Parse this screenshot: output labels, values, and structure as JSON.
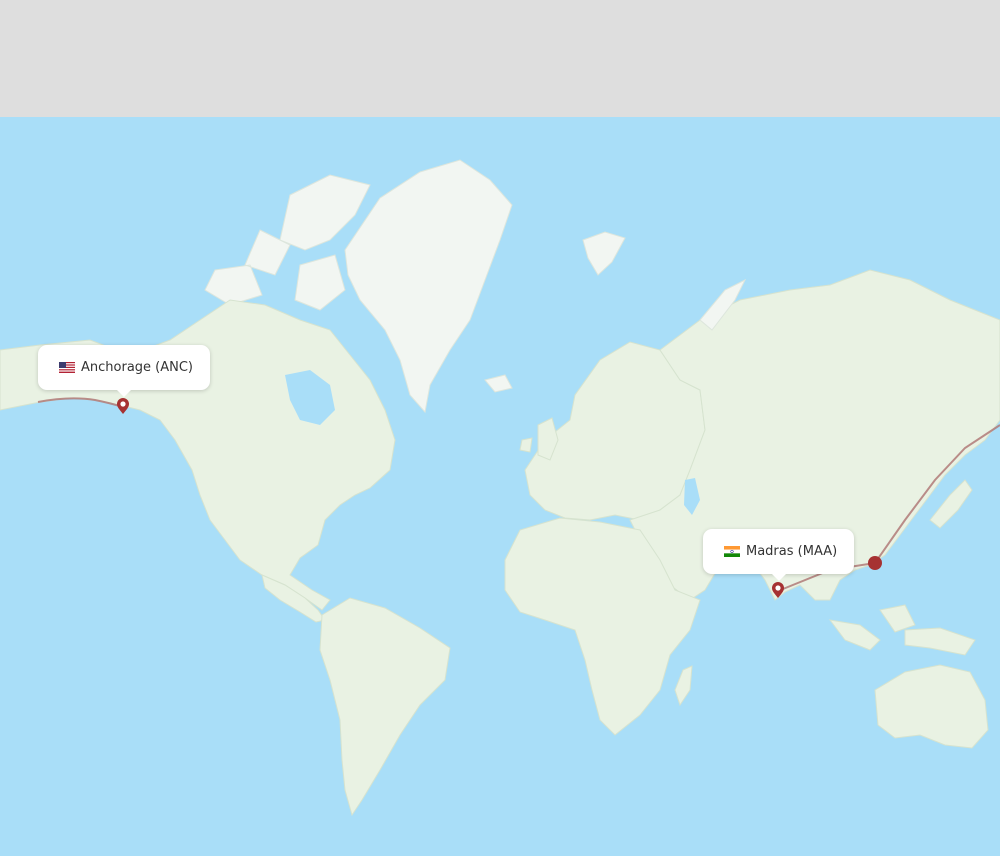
{
  "map": {
    "route": {
      "origin": {
        "name": "Anchorage (ANC)",
        "country": "us-flag-icon"
      },
      "destination": {
        "name": "Madras (MAA)",
        "country": "in-flag-icon"
      }
    },
    "colors": {
      "water": "#a9def8",
      "land": "#e9f2e3",
      "route": "#b07a78",
      "marker": "#a63232",
      "header": "#dedede"
    }
  }
}
